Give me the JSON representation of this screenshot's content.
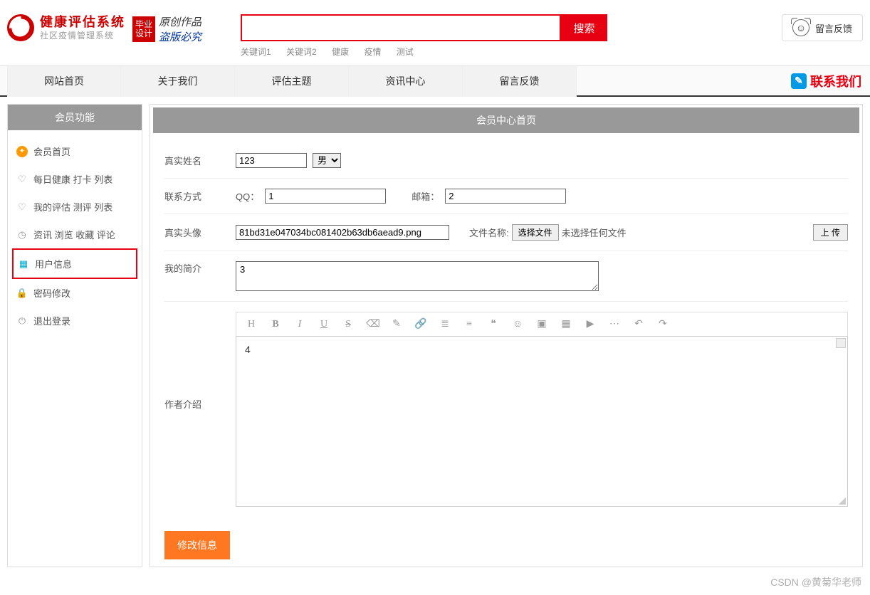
{
  "header": {
    "logo_title": "健康评估系统",
    "logo_sub": "社区疫情管理系统",
    "badge_red": "毕业\n设计",
    "badge_line1": "原创作品",
    "badge_line2": "盗版必究",
    "search_btn": "搜索",
    "keywords": [
      "关键词1",
      "关键词2",
      "健康",
      "疫情",
      "测试"
    ],
    "feedback": "留言反馈"
  },
  "nav": {
    "items": [
      "网站首页",
      "关于我们",
      "评估主题",
      "资讯中心",
      "留言反馈"
    ],
    "contact": "联系我们"
  },
  "sidebar": {
    "title": "会员功能",
    "items": [
      {
        "label": "会员首页"
      },
      {
        "label": "每日健康 打卡 列表"
      },
      {
        "label": "我的评估 测评 列表"
      },
      {
        "label": "资讯 浏览 收藏 评论"
      },
      {
        "label": "用户信息"
      },
      {
        "label": "密码修改"
      },
      {
        "label": "退出登录"
      }
    ]
  },
  "content": {
    "title": "会员中心首页",
    "form": {
      "name_label": "真实姓名",
      "name_value": "123",
      "gender_value": "男",
      "contact_label": "联系方式",
      "qq_label": "QQ：",
      "qq_value": "1",
      "email_label": "邮箱：",
      "email_value": "2",
      "avatar_label": "真实头像",
      "avatar_value": "81bd31e047034bc081402b63db6aead9.png",
      "file_text": "文件名称:",
      "file_btn": "选择文件",
      "file_none": "未选择任何文件",
      "upload_btn": "上 传",
      "intro_label": "我的简介",
      "intro_value": "3",
      "author_label": "作者介绍",
      "editor_content": "4",
      "submit": "修改信息"
    }
  },
  "watermark": "CSDN @黄菊华老师"
}
